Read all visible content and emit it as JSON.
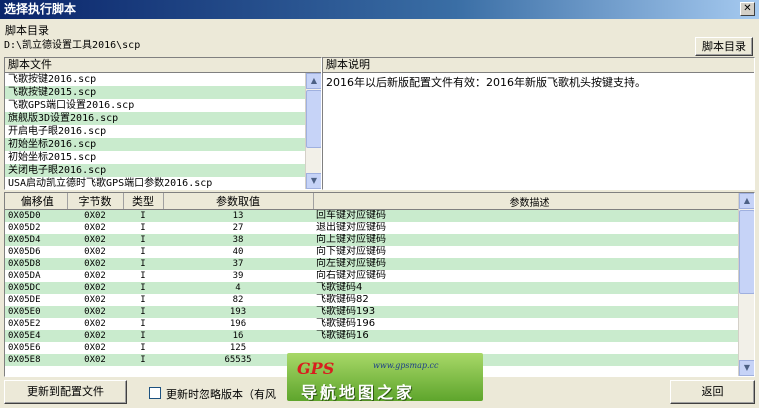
{
  "window": {
    "title": "选择执行脚本",
    "close_glyph": "✕"
  },
  "script_dir": {
    "label": "脚本目录",
    "path": "D:\\凯立德设置工具2016\\scp",
    "button_label": "脚本目录"
  },
  "files_panel": {
    "header": "脚本文件",
    "items": [
      "飞歌按键2016.scp",
      "飞歌按键2015.scp",
      "飞歌GPS端口设置2016.scp",
      "旗舰版3D设置2016.scp",
      "开启电子眼2016.scp",
      "初始坐标2016.scp",
      "初始坐标2015.scp",
      "关闭电子眼2016.scp",
      "USA启动凯立德时飞歌GPS端口参数2016.scp"
    ]
  },
  "desc_panel": {
    "header": "脚本说明",
    "text": "2016年以后新版配置文件有效：2016年新版飞歌机头按键支持。"
  },
  "param_table": {
    "headers": [
      "偏移值",
      "字节数",
      "类型",
      "参数取值",
      "参数描述"
    ],
    "rows": [
      [
        "0X05D0",
        "0X02",
        "I",
        "13",
        "回车键对应键码"
      ],
      [
        "0X05D2",
        "0X02",
        "I",
        "27",
        "退出键对应键码"
      ],
      [
        "0X05D4",
        "0X02",
        "I",
        "38",
        "向上键对应键码"
      ],
      [
        "0X05D6",
        "0X02",
        "I",
        "40",
        "向下键对应键码"
      ],
      [
        "0X05D8",
        "0X02",
        "I",
        "37",
        "向左键对应键码"
      ],
      [
        "0X05DA",
        "0X02",
        "I",
        "39",
        "向右键对应键码"
      ],
      [
        "0X05DC",
        "0X02",
        "I",
        "4",
        "飞歌键码4"
      ],
      [
        "0X05DE",
        "0X02",
        "I",
        "82",
        "飞歌键码82"
      ],
      [
        "0X05E0",
        "0X02",
        "I",
        "193",
        "飞歌键码193"
      ],
      [
        "0X05E2",
        "0X02",
        "I",
        "196",
        "飞歌键码196"
      ],
      [
        "0X05E4",
        "0X02",
        "I",
        "16",
        "飞歌键码16"
      ],
      [
        "0X05E6",
        "0X02",
        "I",
        "125",
        ""
      ],
      [
        "0X05E8",
        "0X02",
        "I",
        "65535",
        ""
      ]
    ]
  },
  "footer": {
    "update_button": "更新到配置文件",
    "ignore_version_label": "更新时忽略版本（有风",
    "back_button": "返回"
  },
  "watermark": {
    "logo": "GPS",
    "url": "www.gpsmap.cc",
    "name": "导航地图之家"
  },
  "colors": {
    "row_alt": "#c9ebcd",
    "window_bg": "#ece9d8",
    "title_bar": "#0a246a"
  }
}
